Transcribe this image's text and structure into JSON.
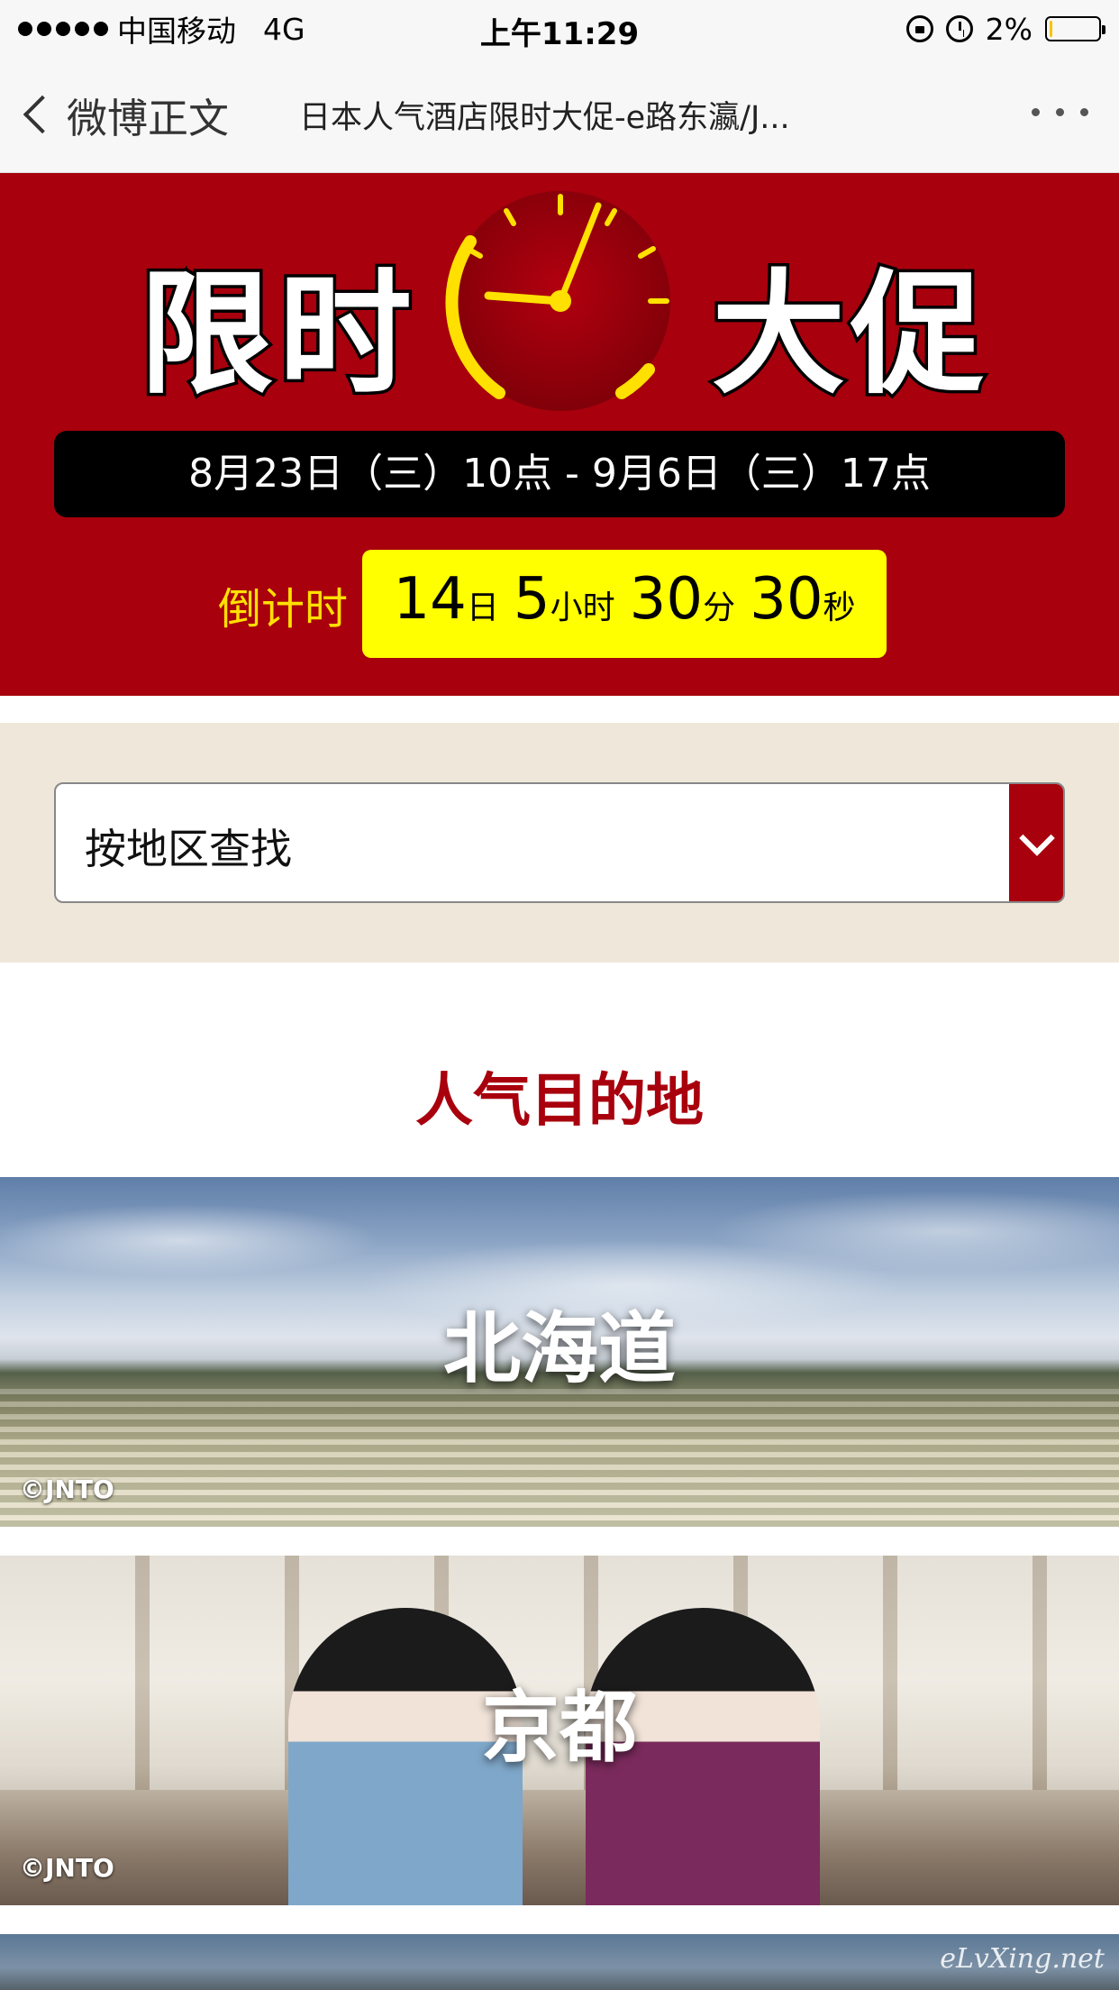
{
  "status_bar": {
    "carrier": "中国移动",
    "network": "4G",
    "time": "上午11:29",
    "battery_text": "2%",
    "battery_level": 0.02
  },
  "nav": {
    "back_label": "微博正文",
    "title": "日本人气酒店限时大促-e路东瀛/J..."
  },
  "banner": {
    "headline_left": "限时",
    "headline_right": "大促",
    "date_range": "8月23日（三）10点 - 9月6日（三）17点",
    "countdown_label": "倒计时",
    "countdown": {
      "days": "14",
      "days_unit": "日",
      "hours": "5",
      "hours_unit": "小时",
      "minutes": "30",
      "minutes_unit": "分",
      "seconds": "30",
      "seconds_unit": "秒"
    }
  },
  "search": {
    "select_label": "按地区查找"
  },
  "popular": {
    "title": "人气目的地",
    "destinations": [
      {
        "name": "北海道",
        "credit": "©JNTO"
      },
      {
        "name": "京都",
        "credit": "©JNTO"
      }
    ],
    "watermark": "eLvXing.net"
  },
  "colors": {
    "brand_red": "#a8000d",
    "countdown_yellow": "#ffff00",
    "search_bg": "#efe8da"
  },
  "icons": {
    "signal": "signal-dots-icon",
    "orientation_lock": "orientation-lock-icon",
    "alarm": "alarm-icon",
    "battery": "battery-icon",
    "back": "chevron-left-icon",
    "more": "more-dots-icon",
    "clock": "clock-icon",
    "dropdown": "chevron-down-icon"
  }
}
